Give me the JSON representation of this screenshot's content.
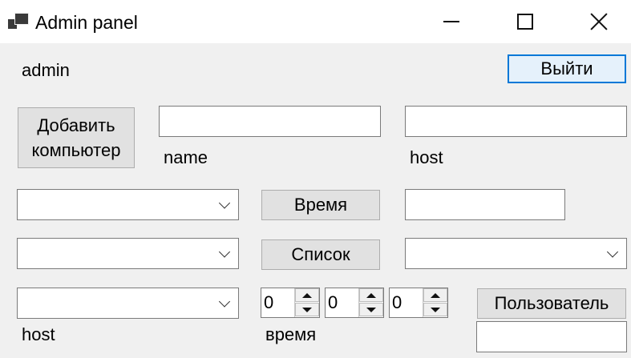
{
  "window": {
    "title": "Admin panel",
    "icon": "app-window-icon",
    "controls": {
      "minimize": "minimize-icon",
      "maximize": "maximize-icon",
      "close": "close-icon"
    }
  },
  "header": {
    "username": "admin",
    "logout_label": "Выйти"
  },
  "add_computer": {
    "button_label": "Добавить компьютер",
    "button_line1": "Добавить",
    "button_line2": "компьютер",
    "name_value": "",
    "name_label": "name",
    "host_value": "",
    "host_label": "host"
  },
  "time_row": {
    "combo_value": "",
    "button_label": "Время",
    "result_value": ""
  },
  "list_row": {
    "combo_value": "",
    "button_label": "Список",
    "result_combo_value": ""
  },
  "user_row": {
    "host_combo_value": "",
    "host_label": "host",
    "time_label": "время",
    "spinner_1": "0",
    "spinner_2": "0",
    "spinner_3": "0",
    "button_label": "Пользователь",
    "result_value": ""
  }
}
